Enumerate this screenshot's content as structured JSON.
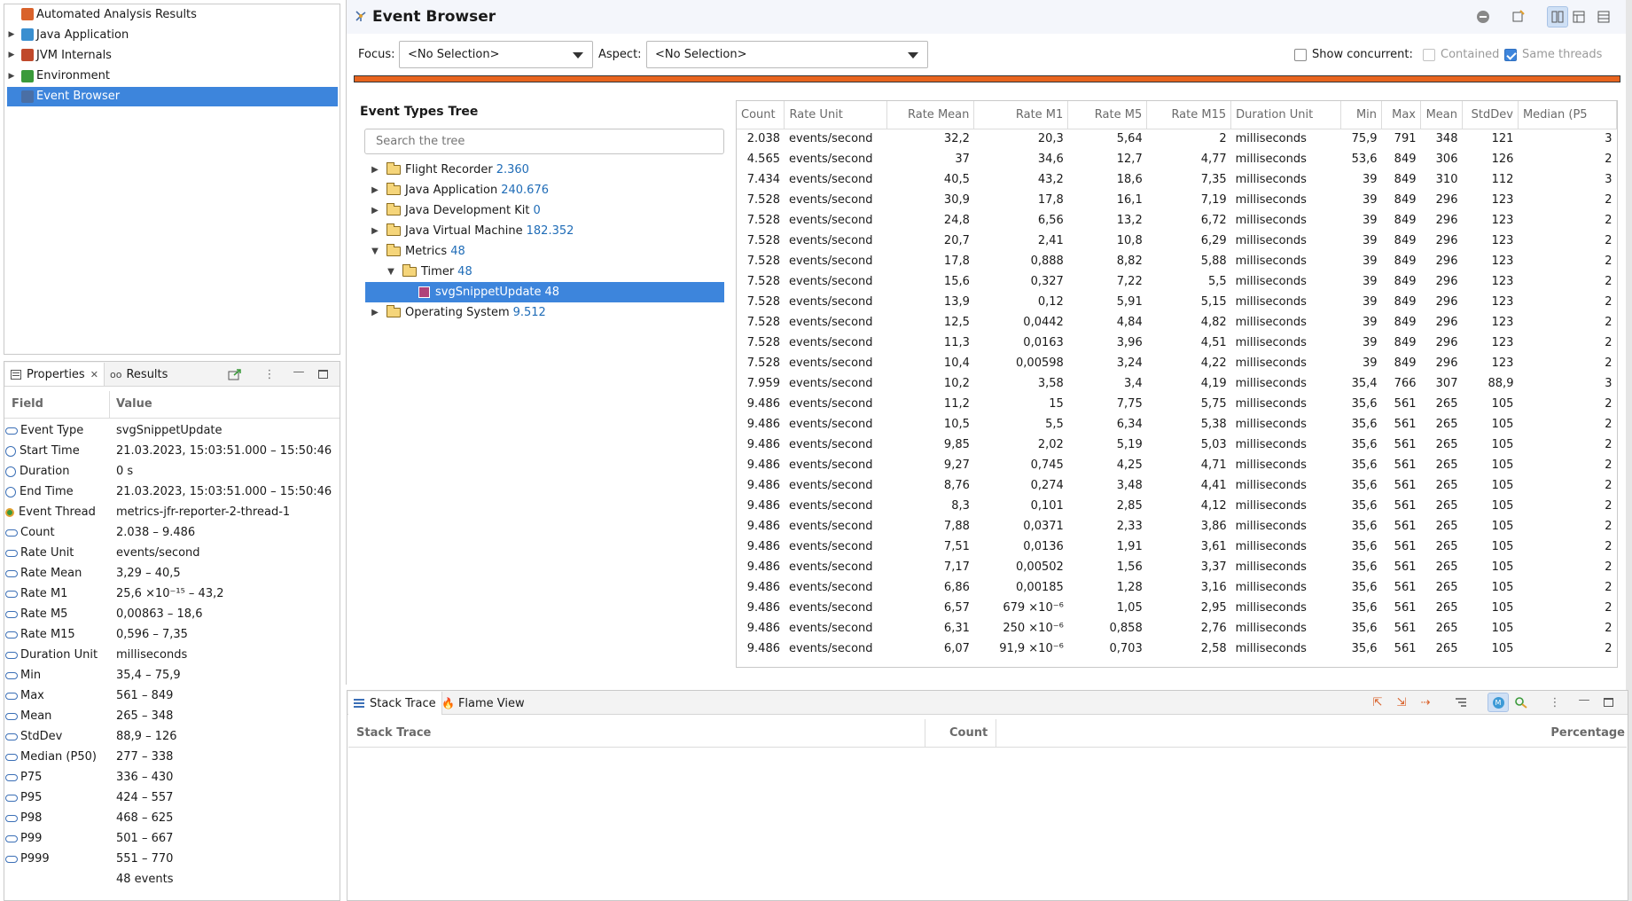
{
  "outline": {
    "items": [
      {
        "label": "Automated Analysis Results",
        "expandable": false
      },
      {
        "label": "Java Application",
        "expandable": true
      },
      {
        "label": "JVM Internals",
        "expandable": true
      },
      {
        "label": "Environment",
        "expandable": true
      },
      {
        "label": "Event Browser",
        "expandable": false,
        "selected": true
      }
    ]
  },
  "properties_panel": {
    "tabs": [
      {
        "label": "Properties",
        "active": true,
        "closable": true
      },
      {
        "label": "Results",
        "active": false
      }
    ],
    "columns": {
      "field": "Field",
      "value": "Value"
    },
    "rows": [
      {
        "field": "Event Type",
        "value": "svgSnippetUpdate",
        "icon": "attribute-icon"
      },
      {
        "field": "Start Time",
        "value": "21.03.2023, 15:03:51.000 – 15:50:46",
        "icon": "clock-icon"
      },
      {
        "field": "Duration",
        "value": "0  s",
        "icon": "stopwatch-icon"
      },
      {
        "field": "End Time",
        "value": "21.03.2023, 15:03:51.000 – 15:50:46",
        "icon": "clock-icon"
      },
      {
        "field": "Event Thread",
        "value": "metrics-jfr-reporter-2-thread-1",
        "icon": "thread-icon"
      },
      {
        "field": "Count",
        "value": "2.038 – 9.486",
        "icon": "attribute-icon"
      },
      {
        "field": "Rate Unit",
        "value": "events/second",
        "icon": "attribute-icon"
      },
      {
        "field": "Rate Mean",
        "value": "3,29 – 40,5",
        "icon": "attribute-icon"
      },
      {
        "field": "Rate M1",
        "value": "25,6  ×10⁻¹⁵ – 43,2",
        "icon": "attribute-icon"
      },
      {
        "field": "Rate M5",
        "value": "0,00863 – 18,6",
        "icon": "attribute-icon"
      },
      {
        "field": "Rate M15",
        "value": "0,596 – 7,35",
        "icon": "attribute-icon"
      },
      {
        "field": "Duration Unit",
        "value": "milliseconds",
        "icon": "attribute-icon"
      },
      {
        "field": "Min",
        "value": "35,4 – 75,9",
        "icon": "attribute-icon"
      },
      {
        "field": "Max",
        "value": "561 – 849",
        "icon": "attribute-icon"
      },
      {
        "field": "Mean",
        "value": "265 – 348",
        "icon": "attribute-icon"
      },
      {
        "field": "StdDev",
        "value": "88,9 – 126",
        "icon": "attribute-icon"
      },
      {
        "field": "Median (P50)",
        "value": "277 – 338",
        "icon": "attribute-icon"
      },
      {
        "field": "P75",
        "value": "336 – 430",
        "icon": "attribute-icon"
      },
      {
        "field": "P95",
        "value": "424 – 557",
        "icon": "attribute-icon"
      },
      {
        "field": "P98",
        "value": "468 – 625",
        "icon": "attribute-icon"
      },
      {
        "field": "P99",
        "value": "501 – 667",
        "icon": "attribute-icon"
      },
      {
        "field": "P999",
        "value": "551 – 770",
        "icon": "attribute-icon"
      },
      {
        "field": "",
        "value": "48 events",
        "icon": ""
      }
    ]
  },
  "event_browser": {
    "title": "Event Browser",
    "focus_label": "Focus:",
    "focus_value": "<No Selection>",
    "aspect_label": "Aspect:",
    "aspect_value": "<No Selection>",
    "show_concurrent_label": "Show concurrent:",
    "show_concurrent_checked": false,
    "contained_label": "Contained",
    "contained_checked": false,
    "same_threads_label": "Same threads",
    "same_threads_checked": true,
    "accent_color": "#e8641e",
    "selection_color": "#3d85dc",
    "tree": {
      "title": "Event Types Tree",
      "search_placeholder": "Search the tree",
      "items": [
        {
          "label": "Flight Recorder",
          "count": "2.360",
          "depth": 0,
          "expanded": false,
          "kind": "folder"
        },
        {
          "label": "Java Application",
          "count": "240.676",
          "depth": 0,
          "expanded": false,
          "kind": "folder"
        },
        {
          "label": "Java Development Kit",
          "count": "0",
          "depth": 0,
          "expanded": false,
          "kind": "folder"
        },
        {
          "label": "Java Virtual Machine",
          "count": "182.352",
          "depth": 0,
          "expanded": false,
          "kind": "folder"
        },
        {
          "label": "Metrics",
          "count": "48",
          "depth": 0,
          "expanded": true,
          "kind": "folder"
        },
        {
          "label": "Timer",
          "count": "48",
          "depth": 1,
          "expanded": true,
          "kind": "folder"
        },
        {
          "label": "svgSnippetUpdate",
          "count": "48",
          "depth": 2,
          "expanded": null,
          "kind": "event",
          "selected": true
        },
        {
          "label": "Operating System",
          "count": "9.512",
          "depth": 0,
          "expanded": false,
          "kind": "folder"
        }
      ]
    },
    "table": {
      "columns": [
        "Count",
        "Rate Unit",
        "Rate Mean",
        "Rate M1",
        "Rate M5",
        "Rate M15",
        "Duration Unit",
        "Min",
        "Max",
        "Mean",
        "StdDev",
        "Median (P5"
      ],
      "rows": [
        [
          "2.038",
          "events/second",
          "32,2",
          "20,3",
          "5,64",
          "2",
          "milliseconds",
          "75,9",
          "791",
          "348",
          "121",
          "3"
        ],
        [
          "4.565",
          "events/second",
          "37",
          "34,6",
          "12,7",
          "4,77",
          "milliseconds",
          "53,6",
          "849",
          "306",
          "126",
          "2"
        ],
        [
          "7.434",
          "events/second",
          "40,5",
          "43,2",
          "18,6",
          "7,35",
          "milliseconds",
          "39",
          "849",
          "310",
          "112",
          "3"
        ],
        [
          "7.528",
          "events/second",
          "30,9",
          "17,8",
          "16,1",
          "7,19",
          "milliseconds",
          "39",
          "849",
          "296",
          "123",
          "2"
        ],
        [
          "7.528",
          "events/second",
          "24,8",
          "6,56",
          "13,2",
          "6,72",
          "milliseconds",
          "39",
          "849",
          "296",
          "123",
          "2"
        ],
        [
          "7.528",
          "events/second",
          "20,7",
          "2,41",
          "10,8",
          "6,29",
          "milliseconds",
          "39",
          "849",
          "296",
          "123",
          "2"
        ],
        [
          "7.528",
          "events/second",
          "17,8",
          "0,888",
          "8,82",
          "5,88",
          "milliseconds",
          "39",
          "849",
          "296",
          "123",
          "2"
        ],
        [
          "7.528",
          "events/second",
          "15,6",
          "0,327",
          "7,22",
          "5,5",
          "milliseconds",
          "39",
          "849",
          "296",
          "123",
          "2"
        ],
        [
          "7.528",
          "events/second",
          "13,9",
          "0,12",
          "5,91",
          "5,15",
          "milliseconds",
          "39",
          "849",
          "296",
          "123",
          "2"
        ],
        [
          "7.528",
          "events/second",
          "12,5",
          "0,0442",
          "4,84",
          "4,82",
          "milliseconds",
          "39",
          "849",
          "296",
          "123",
          "2"
        ],
        [
          "7.528",
          "events/second",
          "11,3",
          "0,0163",
          "3,96",
          "4,51",
          "milliseconds",
          "39",
          "849",
          "296",
          "123",
          "2"
        ],
        [
          "7.528",
          "events/second",
          "10,4",
          "0,00598",
          "3,24",
          "4,22",
          "milliseconds",
          "39",
          "849",
          "296",
          "123",
          "2"
        ],
        [
          "7.959",
          "events/second",
          "10,2",
          "3,58",
          "3,4",
          "4,19",
          "milliseconds",
          "35,4",
          "766",
          "307",
          "88,9",
          "3"
        ],
        [
          "9.486",
          "events/second",
          "11,2",
          "15",
          "7,75",
          "5,75",
          "milliseconds",
          "35,6",
          "561",
          "265",
          "105",
          "2"
        ],
        [
          "9.486",
          "events/second",
          "10,5",
          "5,5",
          "6,34",
          "5,38",
          "milliseconds",
          "35,6",
          "561",
          "265",
          "105",
          "2"
        ],
        [
          "9.486",
          "events/second",
          "9,85",
          "2,02",
          "5,19",
          "5,03",
          "milliseconds",
          "35,6",
          "561",
          "265",
          "105",
          "2"
        ],
        [
          "9.486",
          "events/second",
          "9,27",
          "0,745",
          "4,25",
          "4,71",
          "milliseconds",
          "35,6",
          "561",
          "265",
          "105",
          "2"
        ],
        [
          "9.486",
          "events/second",
          "8,76",
          "0,274",
          "3,48",
          "4,41",
          "milliseconds",
          "35,6",
          "561",
          "265",
          "105",
          "2"
        ],
        [
          "9.486",
          "events/second",
          "8,3",
          "0,101",
          "2,85",
          "4,12",
          "milliseconds",
          "35,6",
          "561",
          "265",
          "105",
          "2"
        ],
        [
          "9.486",
          "events/second",
          "7,88",
          "0,0371",
          "2,33",
          "3,86",
          "milliseconds",
          "35,6",
          "561",
          "265",
          "105",
          "2"
        ],
        [
          "9.486",
          "events/second",
          "7,51",
          "0,0136",
          "1,91",
          "3,61",
          "milliseconds",
          "35,6",
          "561",
          "265",
          "105",
          "2"
        ],
        [
          "9.486",
          "events/second",
          "7,17",
          "0,00502",
          "1,56",
          "3,37",
          "milliseconds",
          "35,6",
          "561",
          "265",
          "105",
          "2"
        ],
        [
          "9.486",
          "events/second",
          "6,86",
          "0,00185",
          "1,28",
          "3,16",
          "milliseconds",
          "35,6",
          "561",
          "265",
          "105",
          "2"
        ],
        [
          "9.486",
          "events/second",
          "6,57",
          "679  ×10⁻⁶",
          "1,05",
          "2,95",
          "milliseconds",
          "35,6",
          "561",
          "265",
          "105",
          "2"
        ],
        [
          "9.486",
          "events/second",
          "6,31",
          "250  ×10⁻⁶",
          "0,858",
          "2,76",
          "milliseconds",
          "35,6",
          "561",
          "265",
          "105",
          "2"
        ],
        [
          "9.486",
          "events/second",
          "6,07",
          "91,9  ×10⁻⁶",
          "0,703",
          "2,58",
          "milliseconds",
          "35,6",
          "561",
          "265",
          "105",
          "2"
        ]
      ]
    }
  },
  "stack_panel": {
    "tabs": [
      {
        "label": "Stack Trace",
        "active": true
      },
      {
        "label": "Flame View",
        "active": false
      }
    ],
    "columns": {
      "stack_trace": "Stack Trace",
      "count": "Count",
      "percentage": "Percentage"
    }
  }
}
